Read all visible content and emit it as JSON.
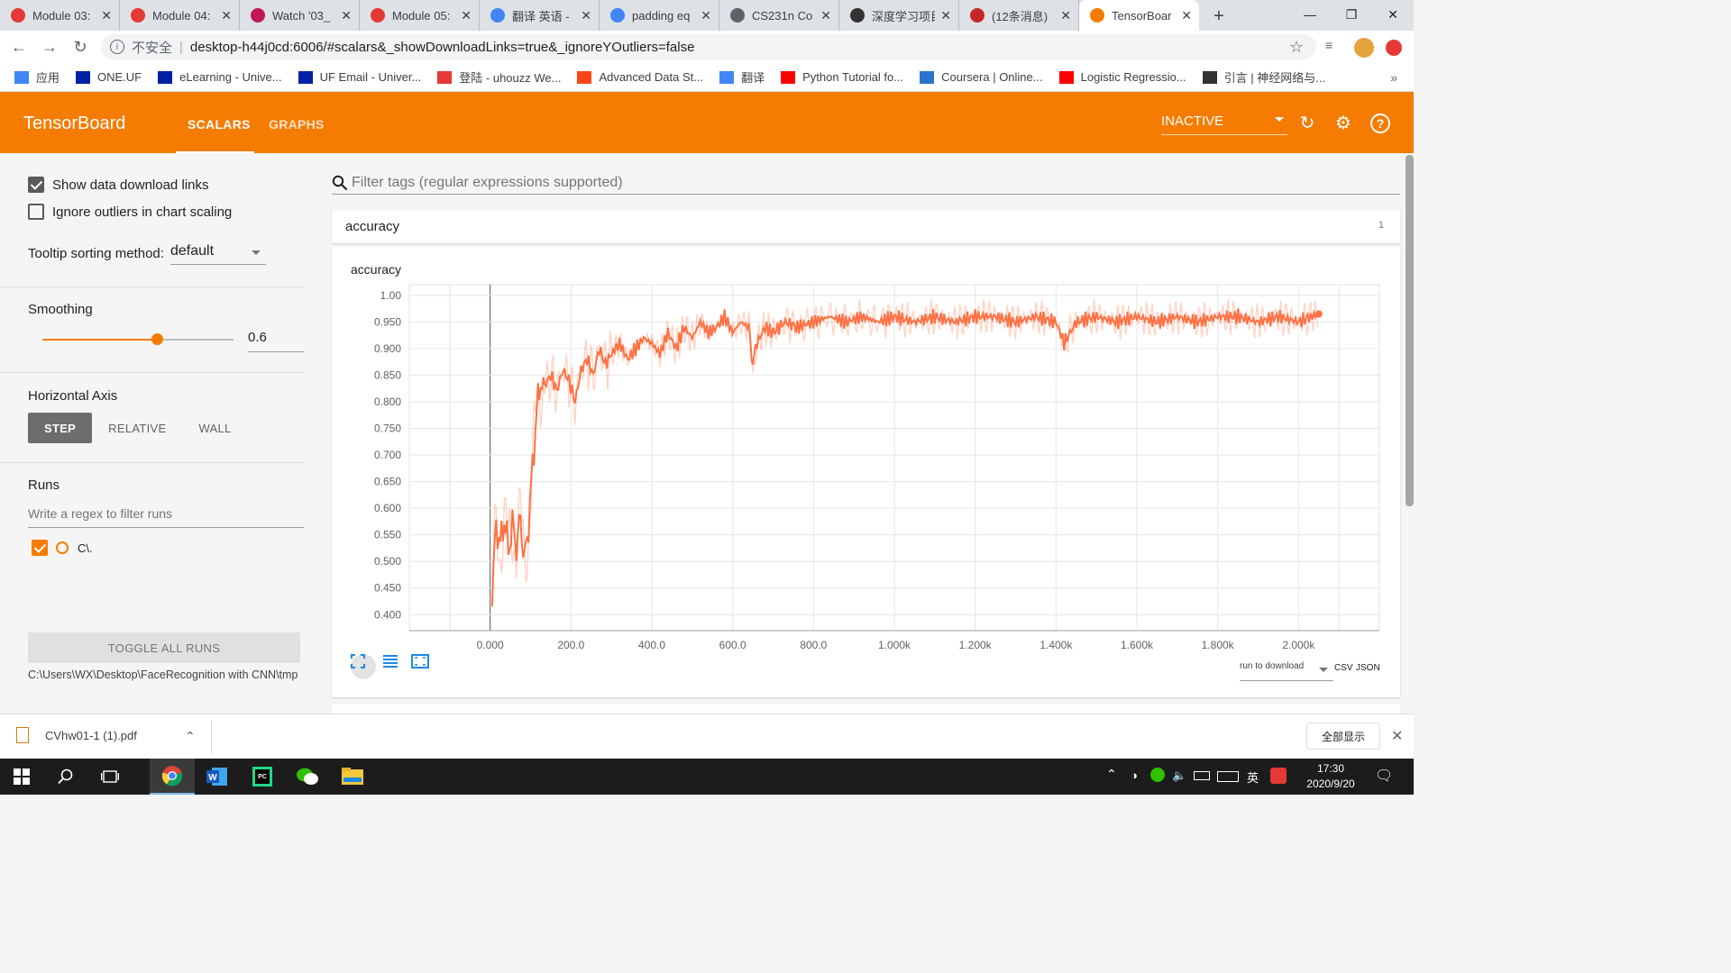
{
  "browser": {
    "tabs": [
      {
        "label": "Module 03:",
        "icon_color": "#e53935",
        "icon": "asterisk-icon"
      },
      {
        "label": "Module 04:",
        "icon_color": "#e53935",
        "icon": "asterisk-icon"
      },
      {
        "label": "Watch '03_",
        "icon_color": "#c2185b",
        "icon": "play-icon"
      },
      {
        "label": "Module 05:",
        "icon_color": "#e53935",
        "icon": "asterisk-icon"
      },
      {
        "label": "翻译 英语 -",
        "icon_color": "#4285f4",
        "icon": "google-icon"
      },
      {
        "label": "padding eq",
        "icon_color": "#4285f4",
        "icon": "google-icon"
      },
      {
        "label": "CS231n Co",
        "icon_color": "#5f6368",
        "icon": "globe-icon"
      },
      {
        "label": "深度学习项目",
        "icon_color": "#333333",
        "icon": "book-icon"
      },
      {
        "label": "(12条消息)",
        "icon_color": "#c62828",
        "icon": "csdn-icon"
      },
      {
        "label": "TensorBoar",
        "icon_color": "#f57c00",
        "icon": "tensorboard-icon"
      }
    ],
    "insecure_label": "不安全",
    "url": "desktop-h44j0cd:6006/#scalars&_showDownloadLinks=true&_ignoreYOutliers=false",
    "bookmarks": [
      {
        "label": "应用",
        "color": "#4285f4"
      },
      {
        "label": "ONE.UF",
        "color": "#0021a5"
      },
      {
        "label": "eLearning - Unive...",
        "color": "#0021a5"
      },
      {
        "label": "UF Email - Univer...",
        "color": "#0021a5"
      },
      {
        "label": "登陆 - uhouzz We...",
        "color": "#e53935"
      },
      {
        "label": "Advanced Data St...",
        "color": "#fa4616"
      },
      {
        "label": "翻译",
        "color": "#4285f4"
      },
      {
        "label": "Python Tutorial fo...",
        "color": "#ff0000"
      },
      {
        "label": "Coursera | Online...",
        "color": "#2a73cc"
      },
      {
        "label": "Logistic Regressio...",
        "color": "#ff0000"
      },
      {
        "label": "引言 | 神经网络与...",
        "color": "#333333"
      }
    ]
  },
  "tensorboard": {
    "title": "TensorBoard",
    "tabs": [
      "SCALARS",
      "GRAPHS"
    ],
    "status": "INACTIVE",
    "accent": "#f57c00"
  },
  "sidebar": {
    "show_download_links": "Show data download links",
    "ignore_outliers": "Ignore outliers in chart scaling",
    "tooltip_label": "Tooltip sorting method:",
    "tooltip_value": "default",
    "smoothing_label": "Smoothing",
    "smoothing_value": "0.6",
    "smoothing_fraction": 0.6,
    "horizontal_axis_label": "Horizontal Axis",
    "axis_options": [
      "STEP",
      "RELATIVE",
      "WALL"
    ],
    "runs_label": "Runs",
    "runs_filter_placeholder": "Write a regex to filter runs",
    "run_name": "C\\.",
    "toggle_all": "TOGGLE ALL RUNS",
    "logdir": "C:\\Users\\WX\\Desktop\\FaceRecognition with CNN\\tmp"
  },
  "main": {
    "filter_placeholder": "Filter tags (regular expressions supported)",
    "category": "accuracy",
    "category_count": "1",
    "download_select": "run to download",
    "download_csv": "CSV",
    "download_json": "JSON"
  },
  "chart_data": {
    "type": "line",
    "title": "accuracy",
    "xlim": [
      -200,
      2200
    ],
    "ylim": [
      0.37,
      1.02
    ],
    "xticks": [
      0,
      200,
      400,
      600,
      800,
      1000,
      1200,
      1400,
      1600,
      1800,
      2000
    ],
    "xtick_labels": [
      "0.000",
      "200.0",
      "400.0",
      "600.0",
      "800.0",
      "1.000k",
      "1.200k",
      "1.400k",
      "1.600k",
      "1.800k",
      "2.000k"
    ],
    "yticks": [
      0.4,
      0.45,
      0.5,
      0.55,
      0.6,
      0.65,
      0.7,
      0.75,
      0.8,
      0.85,
      0.9,
      0.95,
      1.0
    ],
    "ytick_labels": [
      "0.400",
      "0.450",
      "0.500",
      "0.550",
      "0.600",
      "0.650",
      "0.700",
      "0.750",
      "0.800",
      "0.850",
      "0.900",
      "0.950",
      "1.00"
    ],
    "grid": true,
    "series": [
      {
        "color": "#ff7043",
        "x": [
          5,
          15,
          25,
          35,
          45,
          55,
          65,
          75,
          85,
          95,
          105,
          115,
          125,
          135,
          150,
          165,
          180,
          195,
          210,
          225,
          240,
          255,
          270,
          285,
          300,
          320,
          340,
          360,
          380,
          400,
          420,
          440,
          460,
          480,
          500,
          520,
          540,
          560,
          580,
          600,
          620,
          640,
          650,
          660,
          680,
          700,
          730,
          760,
          800,
          840,
          880,
          920,
          960,
          1000,
          1050,
          1100,
          1150,
          1200,
          1250,
          1300,
          1350,
          1400,
          1420,
          1450,
          1500,
          1550,
          1600,
          1650,
          1700,
          1750,
          1800,
          1850,
          1900,
          1950,
          2000,
          2030,
          2050
        ],
        "y": [
          0.44,
          0.57,
          0.53,
          0.58,
          0.52,
          0.57,
          0.53,
          0.58,
          0.5,
          0.57,
          0.68,
          0.78,
          0.84,
          0.83,
          0.85,
          0.82,
          0.86,
          0.84,
          0.8,
          0.86,
          0.88,
          0.85,
          0.9,
          0.87,
          0.89,
          0.91,
          0.88,
          0.9,
          0.92,
          0.91,
          0.89,
          0.93,
          0.9,
          0.94,
          0.92,
          0.95,
          0.93,
          0.94,
          0.96,
          0.93,
          0.95,
          0.94,
          0.87,
          0.91,
          0.94,
          0.93,
          0.95,
          0.94,
          0.95,
          0.96,
          0.95,
          0.96,
          0.95,
          0.96,
          0.95,
          0.96,
          0.95,
          0.96,
          0.96,
          0.95,
          0.96,
          0.95,
          0.91,
          0.95,
          0.96,
          0.95,
          0.96,
          0.95,
          0.96,
          0.95,
          0.96,
          0.96,
          0.95,
          0.96,
          0.95,
          0.96,
          0.965
        ]
      }
    ]
  },
  "download_bar": {
    "file": "CVhw01-1 (1).pdf",
    "show_all": "全部显示"
  },
  "taskbar": {
    "time": "17:30",
    "date": "2020/9/20",
    "ime": "英"
  }
}
